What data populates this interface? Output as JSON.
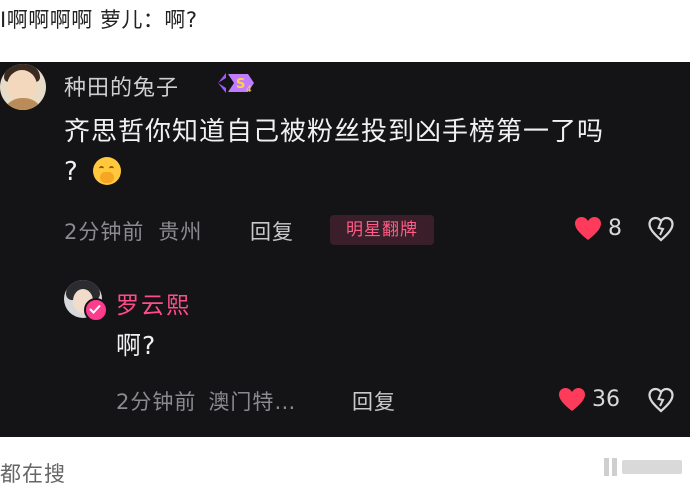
{
  "post": {
    "text": "I啊啊啊啊 萝儿：啊?"
  },
  "comments": [
    {
      "username": "种田的兔子",
      "badge_label": "S4",
      "text": "齐思哲你知道自己被粉丝投到凶手榜第一了吗",
      "text_end": "?",
      "emoji": "face-with-hand-over-mouth",
      "time": "2分钟前",
      "location": "贵州",
      "reply_label": "回复",
      "tag_label": "明星翻牌",
      "likes": "8"
    },
    {
      "username": "罗云熙",
      "text": "啊?",
      "time": "2分钟前",
      "location": "澳门特…",
      "reply_label": "回复",
      "likes": "36"
    }
  ],
  "footer": {
    "text": "都在搜"
  },
  "colors": {
    "background_dark": "#141416",
    "heart_red": "#ff3b5c",
    "accent_pink": "#ff4d8a"
  }
}
